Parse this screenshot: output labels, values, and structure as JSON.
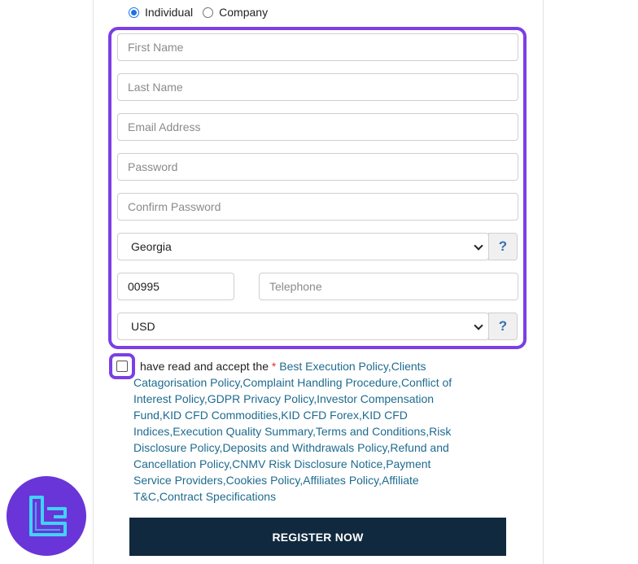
{
  "account_type": {
    "options": [
      "Individual",
      "Company"
    ],
    "selected": "Individual"
  },
  "form": {
    "first_name": {
      "placeholder": "First Name"
    },
    "last_name": {
      "placeholder": "Last Name"
    },
    "email": {
      "placeholder": "Email Address"
    },
    "password": {
      "placeholder": "Password"
    },
    "confirm_password": {
      "placeholder": "Confirm Password"
    },
    "country": {
      "value": "Georgia"
    },
    "country_help": "?",
    "phone_code": {
      "value": "00995"
    },
    "telephone": {
      "placeholder": "Telephone"
    },
    "currency": {
      "value": "USD"
    },
    "currency_help": "?"
  },
  "terms": {
    "prefix": "have read and accept the ",
    "star": "*",
    "links": [
      "Best Execution Policy",
      "Clients Catagorisation Policy",
      "Complaint Handling Procedure",
      "Conflict of Interest Policy",
      "GDPR Privacy Policy",
      "Investor Compensation Fund",
      "KID CFD Commodities",
      "KID CFD Forex",
      "KID CFD Indices",
      "Execution Quality Summary",
      "Terms and Conditions",
      "Risk Disclosure Policy",
      "Deposits and Withdrawals Policy",
      "Refund and Cancellation Policy",
      "CNMV Risk Disclosure Notice",
      "Payment Service Providers",
      "Cookies Policy",
      "Affiliates Policy",
      "Affiliate T&C",
      "Contract Specifications"
    ],
    "separator": ","
  },
  "register_label": "REGISTER NOW",
  "colors": {
    "highlight": "#7b3fe4",
    "button_bg": "#10293e",
    "link": "#1e6b8f",
    "logo_bg": "#6a35d8",
    "logo_mark": "#3fd3f5"
  }
}
